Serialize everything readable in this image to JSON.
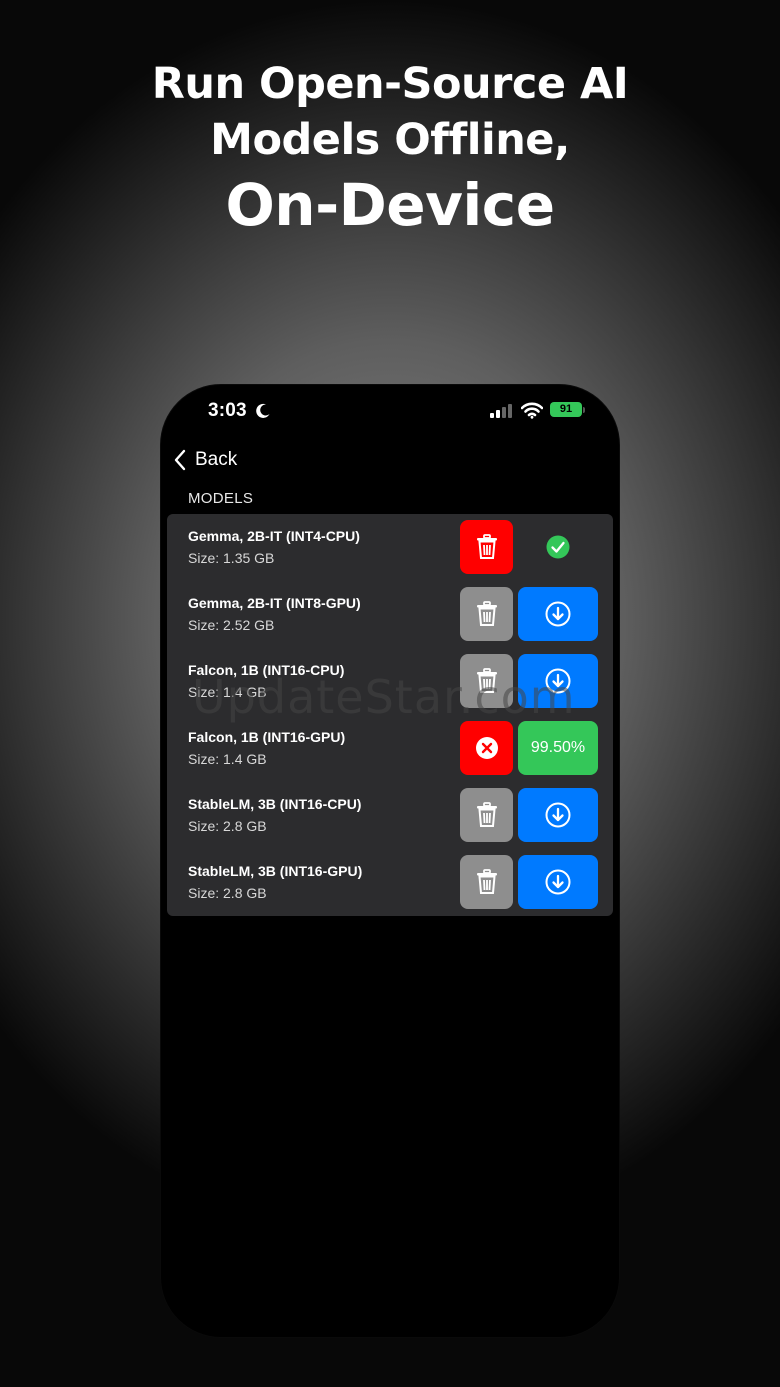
{
  "headline": {
    "line1": "Run Open-Source AI",
    "line2": "Models Offline,",
    "line3": "On-Device"
  },
  "status_bar": {
    "time": "3:03",
    "battery": "91"
  },
  "nav": {
    "back_label": "Back"
  },
  "section": {
    "label": "MODELS"
  },
  "models": [
    {
      "title": "Gemma, 2B-IT (INT4-CPU)",
      "size": "Size: 1.35 GB",
      "state": "downloaded"
    },
    {
      "title": "Gemma, 2B-IT (INT8-GPU)",
      "size": "Size: 2.52 GB",
      "state": "available"
    },
    {
      "title": "Falcon, 1B (INT16-CPU)",
      "size": "Size: 1.4 GB",
      "state": "available"
    },
    {
      "title": "Falcon, 1B (INT16-GPU)",
      "size": "Size: 1.4 GB",
      "state": "downloading",
      "progress": "99.50%"
    },
    {
      "title": "StableLM, 3B (INT16-CPU)",
      "size": "Size: 2.8 GB",
      "state": "available"
    },
    {
      "title": "StableLM, 3B (INT16-GPU)",
      "size": "Size: 2.8 GB",
      "state": "available"
    }
  ],
  "icons": {
    "delete": "trash-icon",
    "download": "download-icon",
    "cancel": "cancel-icon",
    "done": "checkmark-icon"
  },
  "colors": {
    "delete_active": "#ff0000",
    "delete_inactive": "#8e8e8e",
    "download": "#007aff",
    "progress": "#34c759",
    "check": "#34c759"
  },
  "watermark": "UpdateStar.com"
}
